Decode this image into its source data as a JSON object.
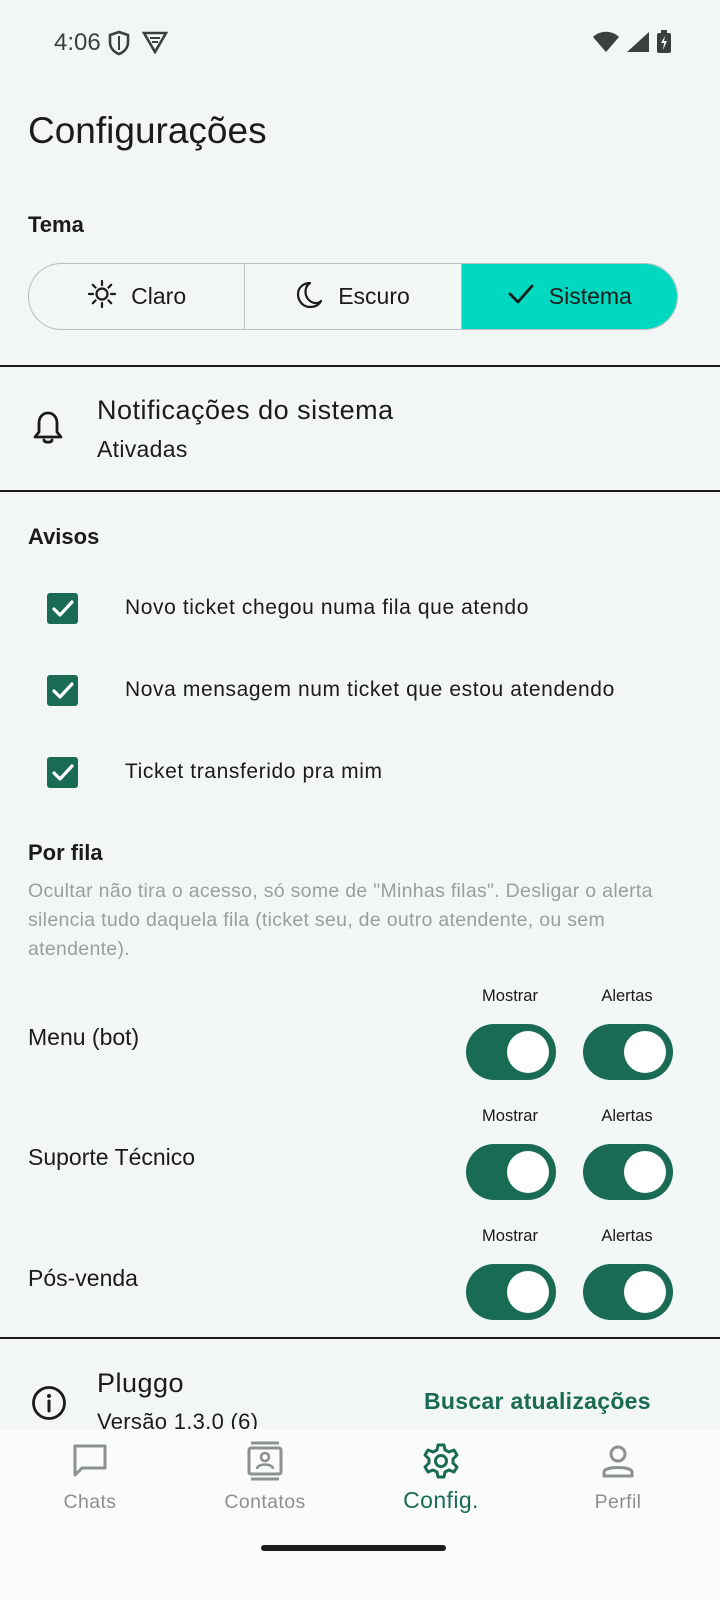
{
  "status_bar": {
    "time": "4:06",
    "left_icons": [
      "shield-icon",
      "vpn-icon"
    ],
    "right_icons": [
      "wifi-icon",
      "signal-icon",
      "battery-charging-icon"
    ]
  },
  "page": {
    "title": "Configurações"
  },
  "theme": {
    "label": "Tema",
    "options": [
      {
        "label": "Claro",
        "icon": "sun-icon",
        "selected": false
      },
      {
        "label": "Escuro",
        "icon": "moon-icon",
        "selected": false
      },
      {
        "label": "Sistema",
        "icon": "check-icon",
        "selected": true
      }
    ]
  },
  "notifications": {
    "title": "Notificações do sistema",
    "status": "Ativadas",
    "icon": "bell-icon"
  },
  "alerts": {
    "label": "Avisos",
    "items": [
      {
        "label": "Novo ticket chegou numa fila que atendo",
        "checked": true
      },
      {
        "label": "Nova mensagem num ticket que estou atendendo",
        "checked": true
      },
      {
        "label": "Ticket transferido pra mim",
        "checked": true
      }
    ]
  },
  "per_queue": {
    "label": "Por fila",
    "help": "Ocultar não tira o acesso, só some de \"Minhas filas\". Desligar o alerta silencia tudo daquela fila (ticket seu, de outro atendente, ou sem atendente).",
    "col_show": "Mostrar",
    "col_alerts": "Alertas",
    "queues": [
      {
        "name": "Menu (bot)",
        "show": true,
        "alerts": true
      },
      {
        "name": "Suporte Técnico",
        "show": true,
        "alerts": true
      },
      {
        "name": "Pós-venda",
        "show": true,
        "alerts": true
      }
    ]
  },
  "about": {
    "app_name": "Pluggo",
    "version": "Versão 1.3.0 (6)",
    "update_button": "Buscar atualizações",
    "icon": "info-icon"
  },
  "bottom_nav": {
    "items": [
      {
        "label": "Chats",
        "icon": "chat-icon",
        "active": false
      },
      {
        "label": "Contatos",
        "icon": "contacts-icon",
        "active": false
      },
      {
        "label": "Config.",
        "icon": "gear-icon",
        "active": true
      },
      {
        "label": "Perfil",
        "icon": "person-icon",
        "active": false
      }
    ]
  },
  "colors": {
    "accent": "#1a6b53",
    "selected_segment": "#00d9c0",
    "background": "#f2f6f5",
    "helper_text": "#9a9f9e"
  }
}
